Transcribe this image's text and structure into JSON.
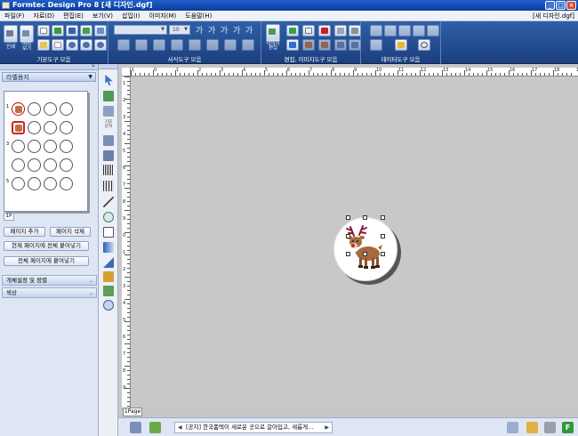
{
  "window": {
    "title": "Formtec Design Pro 8 [새 디자인.dgf]",
    "doc_name": "[새 디자인.dgf]",
    "controls": [
      "_",
      "□",
      "×"
    ]
  },
  "menu": [
    "파일(F)",
    "자료(D)",
    "편집(E)",
    "보기(V)",
    "삽입(I)",
    "이미지(M)",
    "도움말(H)"
  ],
  "ribbon": {
    "groups": [
      {
        "label": "기본도구 모음"
      },
      {
        "label": "서식도구 모음"
      },
      {
        "label": "편집, 이미지도구 모음"
      },
      {
        "label": "데이터도구 모음"
      }
    ],
    "print_label": "인쇄",
    "preview_label": "미리\n보기",
    "font_name": "",
    "font_size": "10",
    "image_edit_label": "이미지\n편집",
    "format_glyphs": [
      "가",
      "가",
      "가",
      "가",
      "가"
    ]
  },
  "left_panel": {
    "selector": "라벨용지",
    "row_numbers": [
      "1",
      "3",
      "5"
    ],
    "page_tab": "1P",
    "buttons": {
      "add_page": "페이지 추가",
      "delete_page": "페이지 삭제",
      "paste_current": "현재 페이지에 전체 붙여넣기",
      "paste_all": "전체 페이지에 붙여넣기"
    },
    "sections": [
      "개체설정 및 정렬",
      "색상"
    ]
  },
  "toolbox": {
    "labels": {
      "special_char": "기호\n문자"
    }
  },
  "rulers": {
    "h_labels": [
      "1",
      "0",
      "1",
      "2",
      "3",
      "4",
      "5",
      "6",
      "7",
      "8",
      "9",
      "10",
      "11",
      "12",
      "13",
      "14",
      "15",
      "16",
      "17",
      "18",
      "19",
      "20"
    ],
    "v_labels": [
      "1",
      "2",
      "3",
      "4",
      "5",
      "6",
      "7",
      "8",
      "9",
      "0",
      "1",
      "2",
      "3",
      "4",
      "5",
      "6",
      "7",
      "8",
      "9"
    ]
  },
  "canvas": {
    "page_indicator": "1Page"
  },
  "status": {
    "notice": "[공지] 한국폼텍이 새로운 곳으로 갈아입고, 새롭게..."
  },
  "colors": {
    "ribbon": "#2f5fa8",
    "panel": "#dfe6f3",
    "canvas": "#c7c7c7"
  }
}
